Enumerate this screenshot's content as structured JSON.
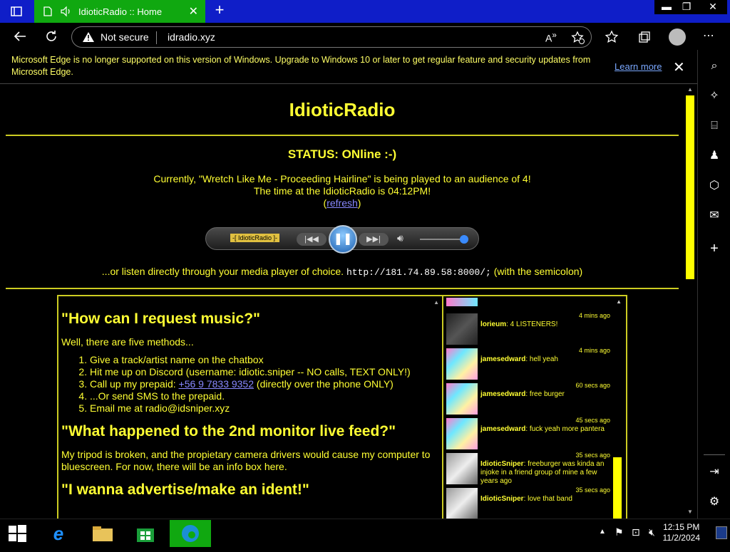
{
  "browser": {
    "tab_title": "IdioticRadio :: Home",
    "tab_close": "✕",
    "new_tab": "+",
    "window_buttons": [
      "▬",
      "❐",
      "✕"
    ],
    "security_label": "Not secure",
    "url": "idradio.xyz"
  },
  "notice": {
    "message": "Microsoft Edge is no longer supported on this version of Windows. Upgrade to Windows 10 or later to get regular feature and security updates from Microsoft Edge.",
    "learn_more": "Learn more",
    "close": "✕"
  },
  "page": {
    "title": "IdioticRadio",
    "status": "STATUS: ONline :-)",
    "now_playing_line1": "Currently, \"Wretch Like Me - Proceeding Hairline\" is being played to an audience of 4!",
    "now_playing_line2": "The time at the IdioticRadio is 04:12PM!",
    "refresh_open": "(",
    "refresh_link": "refresh",
    "refresh_close": ")",
    "player_label": "-[ IdioticRadio ]-",
    "direct_text": "...or listen directly through your media player of choice.",
    "stream_url": "http://181.74.89.58:8000/;",
    "direct_suffix": "(with the semicolon)"
  },
  "faq": {
    "q1": "\"How can I request music?\"",
    "q1_intro": "Well, there are five methods...",
    "methods": [
      "Give a track/artist name on the chatbox",
      "Hit me up on Discord (username: idiotic.sniper -- NO calls, TEXT ONLY!)",
      "Call up my prepaid:",
      "...Or send SMS to the prepaid.",
      "Email me at radio@idsniper.xyz"
    ],
    "phone": "+56 9 7833 9352",
    "phone_suffix": "(directly over the phone ONLY)",
    "q2": "\"What happened to the 2nd monitor live feed?\"",
    "q2_answer": "My tripod is broken, and the propietary camera drivers would cause my computer to bluescreen. For now, there will be an info box here.",
    "q3": "\"I wanna advertise/make an ident!\""
  },
  "chat": [
    {
      "time": "4 mins ago",
      "user": "lorieum",
      "text": ": 4 LISTENERS!",
      "avatar": "dark"
    },
    {
      "time": "4 mins ago",
      "user": "jamesedward",
      "text": ": hell yeah",
      "avatar": "pink"
    },
    {
      "time": "60 secs ago",
      "user": "jamesedward",
      "text": ": free burger",
      "avatar": "pink"
    },
    {
      "time": "45 secs ago",
      "user": "jamesedward",
      "text": ": fuck yeah more pantera",
      "avatar": "pink"
    },
    {
      "time": "35 secs ago",
      "user": "IdioticSniper",
      "text": ": freeburger was kinda an injoke in a friend group of mine a few years ago",
      "avatar": "gray"
    },
    {
      "time": "35 secs ago",
      "user": "IdioticSniper",
      "text": ": love that band",
      "avatar": "gray"
    }
  ],
  "taskbar": {
    "time": "12:15 PM",
    "date": "11/2/2024"
  }
}
